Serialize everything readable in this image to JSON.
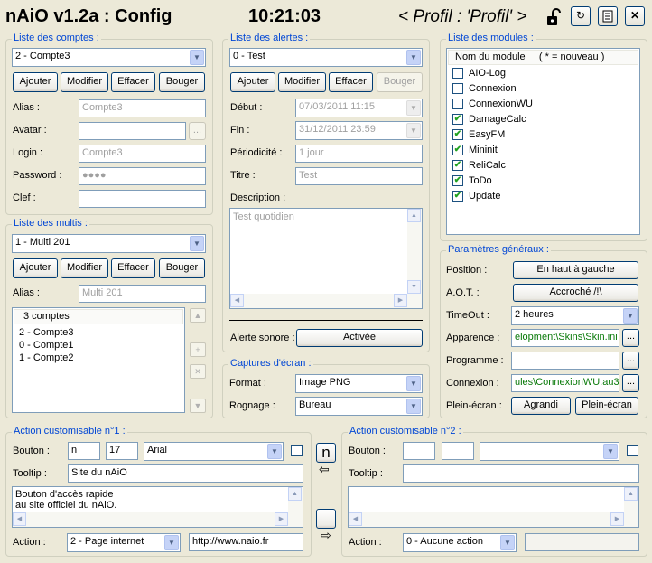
{
  "header": {
    "title": "nAiO v1.2a : Config",
    "time": "10:21:03",
    "profil": "< Profil : 'Profil' >"
  },
  "comptes": {
    "legend": "Liste des comptes :",
    "selected": "2 - Compte3",
    "buttons": [
      "Ajouter",
      "Modifier",
      "Effacer",
      "Bouger"
    ],
    "alias_label": "Alias :",
    "alias": "Compte3",
    "avatar_label": "Avatar :",
    "avatar_browse": "...",
    "login_label": "Login :",
    "login": "Compte3",
    "password_label": "Password :",
    "password": "●●●●",
    "clef_label": "Clef :"
  },
  "multis": {
    "legend": "Liste des multis :",
    "selected": "1 - Multi 201",
    "buttons": [
      "Ajouter",
      "Modifier",
      "Effacer",
      "Bouger"
    ],
    "alias_label": "Alias :",
    "alias": "Multi 201",
    "header": "3 comptes",
    "items": [
      "2 - Compte3",
      "0 - Compte1",
      "1 - Compte2"
    ]
  },
  "alertes": {
    "legend": "Liste des alertes :",
    "selected": "0 - Test",
    "buttons": [
      "Ajouter",
      "Modifier",
      "Effacer",
      "Bouger"
    ],
    "debut_label": "Début :",
    "debut": "07/03/2011 11:15",
    "fin_label": "Fin :",
    "fin": "31/12/2011 23:59",
    "periodicite_label": "Périodicité :",
    "periodicite": "1 jour",
    "titre_label": "Titre :",
    "titre": "Test",
    "description_label": "Description :",
    "description": "Test quotidien",
    "sonore_label": "Alerte sonore :",
    "sonore": "Activée"
  },
  "captures": {
    "legend": "Captures d'écran :",
    "format_label": "Format :",
    "format": "Image PNG",
    "rognage_label": "Rognage :",
    "rognage": "Bureau"
  },
  "modules": {
    "legend": "Liste des modules :",
    "header": "Nom du module     ( * = nouveau )",
    "items": [
      {
        "name": "AIO-Log",
        "checked": false
      },
      {
        "name": "Connexion",
        "checked": false
      },
      {
        "name": "ConnexionWU",
        "checked": false
      },
      {
        "name": "DamageCalc",
        "checked": true
      },
      {
        "name": "EasyFM",
        "checked": true
      },
      {
        "name": "Mininit",
        "checked": true
      },
      {
        "name": "ReliCalc",
        "checked": true
      },
      {
        "name": "ToDo",
        "checked": true
      },
      {
        "name": "Update",
        "checked": true
      }
    ]
  },
  "params": {
    "legend": "Paramètres généraux :",
    "position_label": "Position :",
    "position": "En haut à gauche",
    "aot_label": "A.O.T. :",
    "aot": "Accroché /!\\",
    "timeout_label": "TimeOut :",
    "timeout": "2 heures",
    "apparence_label": "Apparence :",
    "apparence": "elopment\\Skins\\Skin.ini",
    "programme_label": "Programme :",
    "connexion_label": "Connexion :",
    "connexion": "ules\\ConnexionWU.au3",
    "plein_label": "Plein-écran :",
    "agrandi": "Agrandi",
    "plein": "Plein-écran",
    "browse": "..."
  },
  "action1": {
    "legend": "Action customisable n°1 :",
    "bouton_label": "Bouton :",
    "bouton_text": "n",
    "size": "17",
    "font": "Arial",
    "tooltip_label": "Tooltip :",
    "tooltip": "Site du nAiO",
    "description": "Bouton d'accès rapide\nau site officiel du nAiO.",
    "action_label": "Action :",
    "action": "2 - Page internet",
    "url": "http://www.naio.fr"
  },
  "action2": {
    "legend": "Action customisable n°2 :",
    "bouton_label": "Bouton :",
    "tooltip_label": "Tooltip :",
    "action_label": "Action :",
    "action": "0 - Aucune action"
  },
  "preview": {
    "btn1": "n",
    "arrow1": "⇦",
    "arrow2": "⇨"
  },
  "colors": {
    "legend": "#0046d5",
    "border": "#7f9db9",
    "bg": "#ece9d8",
    "check": "#21a121"
  }
}
